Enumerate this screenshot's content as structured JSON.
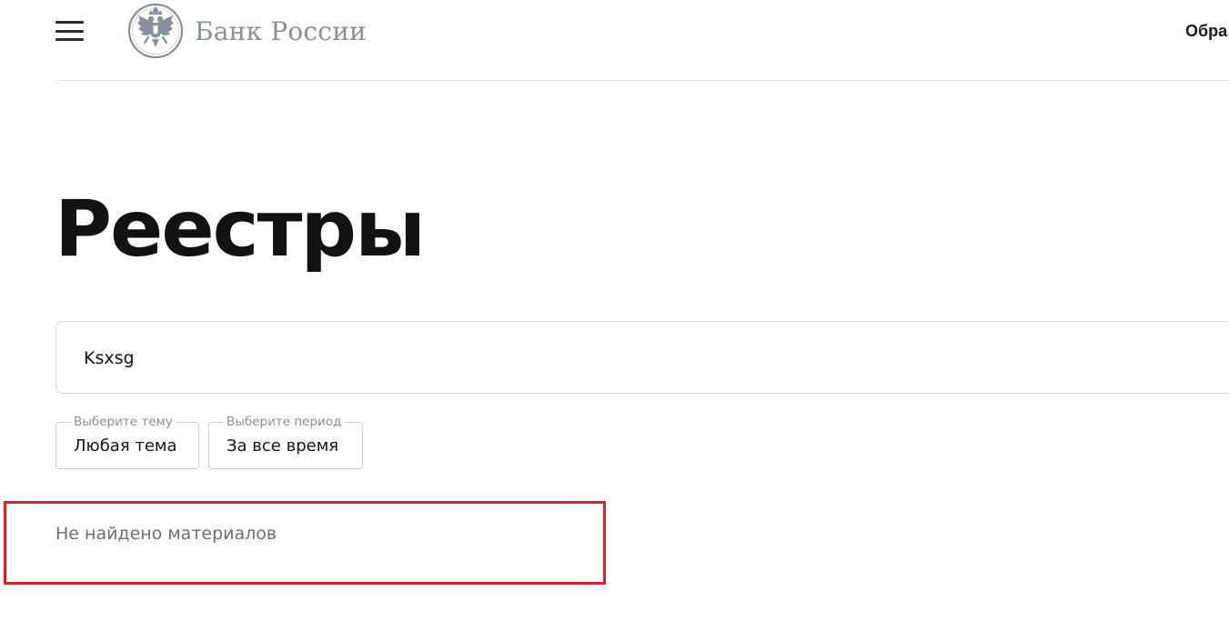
{
  "header": {
    "brand_name": "Банк России",
    "nav_link": "Обра"
  },
  "main": {
    "title": "Реестры",
    "search": {
      "value": "Ksxsg"
    },
    "filters": [
      {
        "legend": "Выберите тему",
        "value": "Любая тема"
      },
      {
        "legend": "Выберите период",
        "value": "За все время"
      }
    ],
    "result_message": "Не найдено материалов"
  },
  "icons": {
    "menu": "hamburger-menu-icon",
    "logo": "double-headed-eagle-emblem"
  },
  "colors": {
    "brand_gray": "#8a8f99",
    "highlight_red": "#e02028",
    "text_dark": "#121212",
    "muted_text": "#6b6f78"
  }
}
